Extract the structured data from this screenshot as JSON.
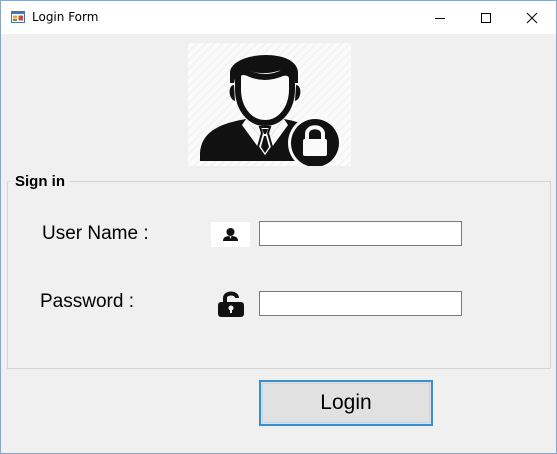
{
  "window": {
    "title": "Login Form",
    "controls": {
      "minimize_icon": "minimize-icon",
      "maximize_icon": "maximize-icon",
      "close_icon": "close-icon"
    }
  },
  "header_image": {
    "icon": "user-lock-icon"
  },
  "signin_group": {
    "title": "Sign in",
    "username_label": "User Name :",
    "username_value": "",
    "username_icon": "user-icon",
    "password_label": "Password :",
    "password_value": "",
    "password_icon": "unlock-icon"
  },
  "login_button": {
    "label": "Login"
  },
  "colors": {
    "window_bg": "#f0f0f0",
    "titlebar_bg": "#ffffff",
    "button_border": "#3a8fd0",
    "icon_color": "#111111"
  }
}
